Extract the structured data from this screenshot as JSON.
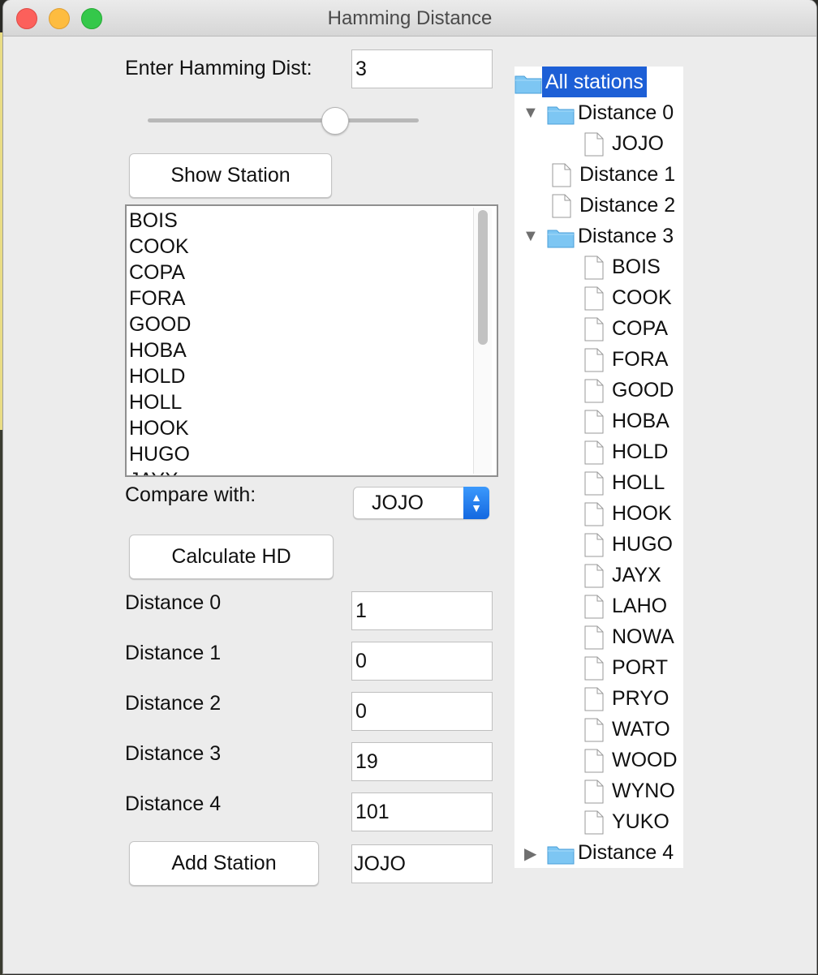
{
  "window": {
    "title": "Hamming Distance"
  },
  "form": {
    "hamming_label": "Enter Hamming Dist:",
    "hamming_value": "3",
    "slider_value": 3,
    "show_station_label": "Show Station",
    "station_list": [
      "BOIS",
      "COOK",
      "COPA",
      "FORA",
      "GOOD",
      "HOBA",
      "HOLD",
      "HOLL",
      "HOOK",
      "HUGO",
      "JAYX"
    ],
    "compare_label": "Compare with:",
    "compare_value": "JOJO",
    "calculate_label": "Calculate HD",
    "distances": [
      {
        "label": "Distance 0",
        "value": "1"
      },
      {
        "label": "Distance 1",
        "value": "0"
      },
      {
        "label": "Distance 2",
        "value": "0"
      },
      {
        "label": "Distance 3",
        "value": "19"
      },
      {
        "label": "Distance 4",
        "value": "101"
      }
    ],
    "add_station_label": "Add Station",
    "add_station_value": "JOJO"
  },
  "tree": {
    "root": "All stations",
    "distance0": {
      "label": "Distance 0",
      "children": [
        "JOJO"
      ]
    },
    "distance1": {
      "label": "Distance 1"
    },
    "distance2": {
      "label": "Distance 2"
    },
    "distance3": {
      "label": "Distance 3",
      "children": [
        "BOIS",
        "COOK",
        "COPA",
        "FORA",
        "GOOD",
        "HOBA",
        "HOLD",
        "HOLL",
        "HOOK",
        "HUGO",
        "JAYX",
        "LAHO",
        "NOWA",
        "PORT",
        "PRYO",
        "WATO",
        "WOOD",
        "WYNO",
        "YUKO"
      ]
    },
    "distance4": {
      "label": "Distance 4"
    }
  },
  "icons": {
    "folder": "folder-icon",
    "file": "file-icon",
    "expanded": "triangle-down-icon",
    "collapsed": "triangle-right-icon"
  },
  "colors": {
    "selection": "#1d5fd6",
    "folder": "#7dc6f3",
    "stepper": "#1f78f0"
  }
}
